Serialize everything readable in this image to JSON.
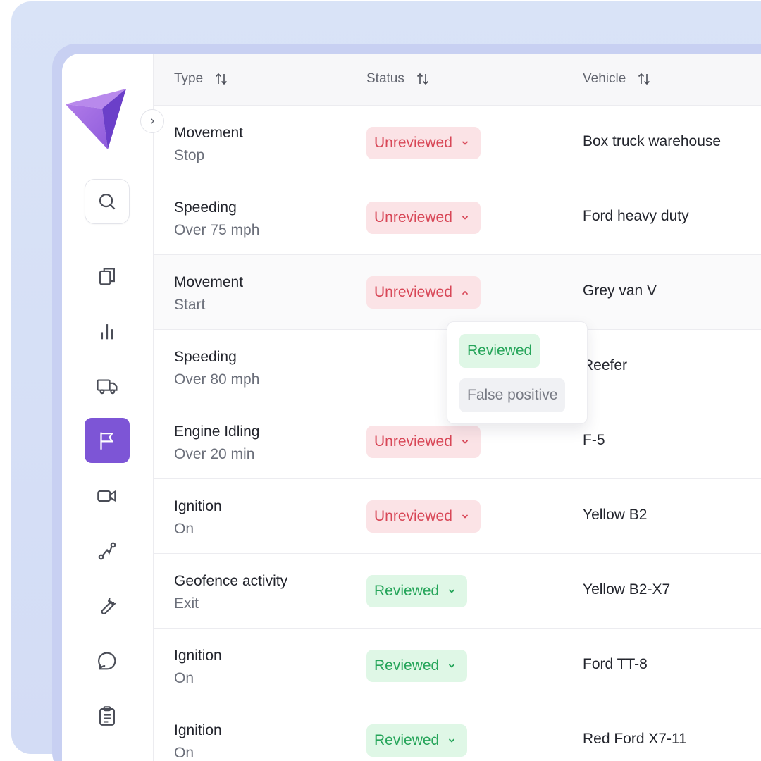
{
  "colors": {
    "accent": "#7d55d6",
    "unreviewed_text": "#d84757",
    "unreviewed_bg": "#fbe3e6",
    "reviewed_text": "#26a55a",
    "reviewed_bg": "#dff7e6"
  },
  "sidebar": {
    "collapse_icon": "chevron-right-icon",
    "items": [
      {
        "icon": "search-icon"
      },
      {
        "icon": "copy-icon"
      },
      {
        "icon": "bar-chart-icon"
      },
      {
        "icon": "truck-icon"
      },
      {
        "icon": "flag-icon",
        "active": true
      },
      {
        "icon": "video-camera-icon"
      },
      {
        "icon": "route-icon"
      },
      {
        "icon": "wrench-icon"
      },
      {
        "icon": "speech-bubble-icon"
      },
      {
        "icon": "clipboard-icon"
      }
    ]
  },
  "table": {
    "columns": [
      {
        "label": "Type"
      },
      {
        "label": "Status"
      },
      {
        "label": "Vehicle"
      }
    ],
    "rows": [
      {
        "type": "Movement",
        "detail": "Stop",
        "status": "Unreviewed",
        "status_kind": "unreviewed",
        "vehicle": "Box truck warehouse"
      },
      {
        "type": "Speeding",
        "detail": "Over 75 mph",
        "status": "Unreviewed",
        "status_kind": "unreviewed",
        "vehicle": "Ford heavy duty"
      },
      {
        "type": "Movement",
        "detail": "Start",
        "status": "Unreviewed",
        "status_kind": "unreviewed",
        "vehicle": "Grey van V",
        "expanded": true
      },
      {
        "type": "Speeding",
        "detail": "Over 80 mph",
        "status": "",
        "status_kind": "hidden",
        "vehicle": "Reefer"
      },
      {
        "type": "Engine Idling",
        "detail": "Over 20 min",
        "status": "Unreviewed",
        "status_kind": "unreviewed",
        "vehicle": "F-5"
      },
      {
        "type": "Ignition",
        "detail": "On",
        "status": "Unreviewed",
        "status_kind": "unreviewed",
        "vehicle": "Yellow B2"
      },
      {
        "type": "Geofence activity",
        "detail": "Exit",
        "status": "Reviewed",
        "status_kind": "reviewed",
        "vehicle": "Yellow B2-X7"
      },
      {
        "type": "Ignition",
        "detail": "On",
        "status": "Reviewed",
        "status_kind": "reviewed",
        "vehicle": "Ford TT-8"
      },
      {
        "type": "Ignition",
        "detail": "On",
        "status": "Reviewed",
        "status_kind": "reviewed",
        "vehicle": "Red Ford X7-11"
      }
    ]
  },
  "status_dropdown": {
    "options": [
      "Reviewed",
      "False positive"
    ]
  }
}
